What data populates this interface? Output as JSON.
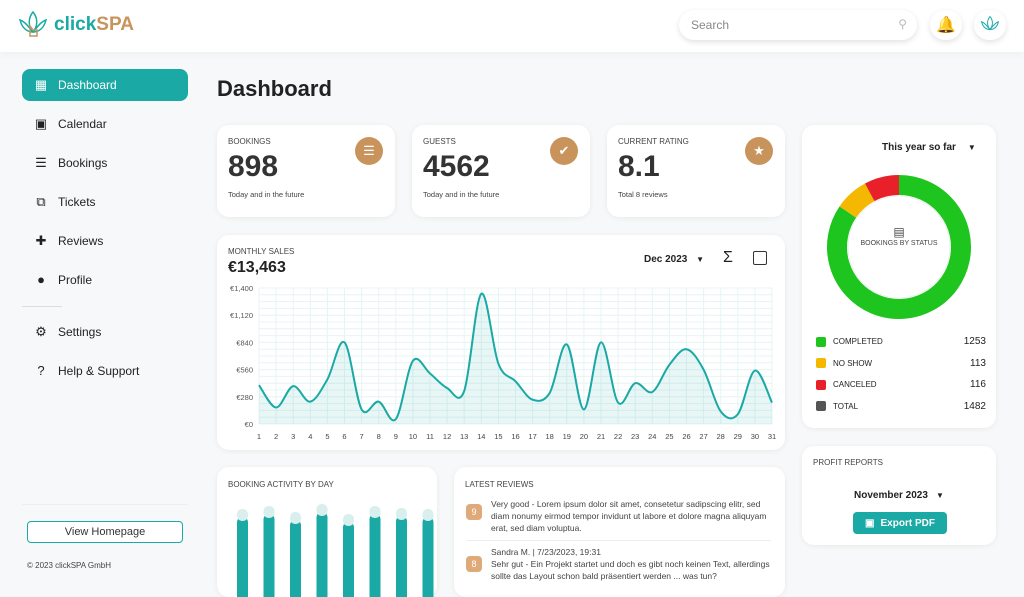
{
  "brand": {
    "name_a": "click",
    "name_b": "SPA"
  },
  "header": {
    "search_placeholder": "Search"
  },
  "sidebar": {
    "items": [
      {
        "label": "Dashboard",
        "icon": "dashboard-icon",
        "active": true
      },
      {
        "label": "Calendar",
        "icon": "calendar-icon"
      },
      {
        "label": "Bookings",
        "icon": "list-icon"
      },
      {
        "label": "Tickets",
        "icon": "ticket-icon"
      },
      {
        "label": "Reviews",
        "icon": "review-icon"
      },
      {
        "label": "Profile",
        "icon": "person-icon"
      }
    ],
    "items2": [
      {
        "label": "Settings",
        "icon": "gear-icon"
      },
      {
        "label": "Help & Support",
        "icon": "help-icon"
      }
    ],
    "view_homepage": "View Homepage",
    "copyright": "© 2023 clickSPA GmbH"
  },
  "page_title": "Dashboard",
  "kpis": [
    {
      "label": "Bookings",
      "value": "898",
      "sub": "Today and in the future",
      "icon": "list-icon"
    },
    {
      "label": "Guests",
      "value": "4562",
      "sub": "Today and in the future",
      "icon": "guest-icon"
    },
    {
      "label": "Current rating",
      "value": "8.1",
      "sub": "Total 8 reviews",
      "icon": "star-icon"
    }
  ],
  "sales": {
    "label": "Monthly Sales",
    "total": "€13,463",
    "period": "Dec 2023"
  },
  "chart_data": [
    {
      "type": "area",
      "title": "",
      "x": [
        1,
        2,
        3,
        4,
        5,
        6,
        7,
        8,
        9,
        10,
        11,
        12,
        13,
        14,
        15,
        16,
        17,
        18,
        19,
        20,
        21,
        22,
        23,
        24,
        25,
        26,
        27,
        28,
        29,
        30,
        31
      ],
      "values": [
        400,
        170,
        390,
        230,
        460,
        840,
        150,
        230,
        50,
        650,
        520,
        370,
        340,
        1340,
        620,
        440,
        250,
        320,
        820,
        150,
        840,
        220,
        420,
        330,
        610,
        770,
        560,
        130,
        100,
        550,
        220
      ],
      "ylim": [
        0,
        1400
      ],
      "yticks": [
        "€0",
        "€280",
        "€560",
        "€840",
        "€1,120",
        "€1,400"
      ],
      "grid": true,
      "color": "#1aa9a4"
    },
    {
      "type": "pie",
      "title": "Bookings by status",
      "period": "This year so far",
      "categories": [
        "Completed",
        "No show",
        "Canceled"
      ],
      "values": [
        1253,
        113,
        116
      ],
      "colors": [
        "#1ec51e",
        "#f5b800",
        "#e8202a"
      ],
      "total_label": "Total",
      "total": 1482,
      "total_color": "#555555"
    }
  ],
  "activity": {
    "label": "Booking activity by day"
  },
  "reviews": {
    "label": "Latest reviews",
    "items": [
      {
        "score": "9",
        "meta": "",
        "text": "Very good - Lorem ipsum dolor sit amet, consetetur sadipscing elitr, sed diam nonumy eirmod tempor invidunt ut labore et dolore magna aliquyam erat, sed diam voluptua."
      },
      {
        "score": "8",
        "meta": "Sandra M. | 7/23/2023, 19:31",
        "text": "Sehr gut - Ein Projekt startet und doch es gibt noch keinen Text, allerdings sollte das Layout schon bald präsentiert werden ... was tun?"
      }
    ]
  },
  "profit": {
    "label": "Profit reports",
    "period": "November 2023",
    "export": "Export PDF"
  }
}
